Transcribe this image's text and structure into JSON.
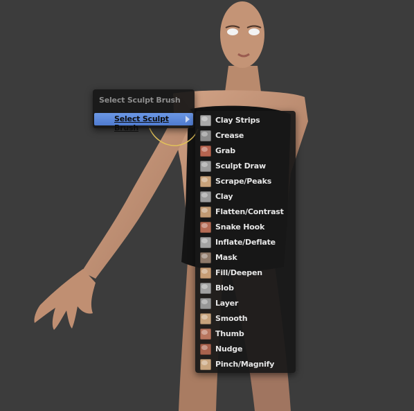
{
  "menus": {
    "parent": {
      "title": "Select Sculpt Brush",
      "item_label": "Select Sculpt Brush"
    },
    "brushes": [
      {
        "label": "Clay Strips",
        "icon": "clay-strips-brush-icon",
        "color": "#a9a9a9"
      },
      {
        "label": "Crease",
        "icon": "crease-brush-icon",
        "color": "#8c8c8c"
      },
      {
        "label": "Grab",
        "icon": "grab-brush-icon",
        "color": "#b5634f"
      },
      {
        "label": "Sculpt Draw",
        "icon": "sculpt-draw-brush-icon",
        "color": "#9c9c9c"
      },
      {
        "label": "Scrape/Peaks",
        "icon": "scrape-peaks-brush-icon",
        "color": "#c8a27a"
      },
      {
        "label": "Clay",
        "icon": "clay-brush-icon",
        "color": "#9b9b9b"
      },
      {
        "label": "Flatten/Contrast",
        "icon": "flatten-contrast-brush-icon",
        "color": "#c19a73"
      },
      {
        "label": "Snake Hook",
        "icon": "snake-hook-brush-icon",
        "color": "#b46b55"
      },
      {
        "label": "Inflate/Deflate",
        "icon": "inflate-deflate-brush-icon",
        "color": "#a3a3a3"
      },
      {
        "label": "Mask",
        "icon": "mask-brush-icon",
        "color": "#8f7a6a"
      },
      {
        "label": "Fill/Deepen",
        "icon": "fill-deepen-brush-icon",
        "color": "#c79d75"
      },
      {
        "label": "Blob",
        "icon": "blob-brush-icon",
        "color": "#a1a1a1"
      },
      {
        "label": "Layer",
        "icon": "layer-brush-icon",
        "color": "#979797"
      },
      {
        "label": "Smooth",
        "icon": "smooth-brush-icon",
        "color": "#c6a27c"
      },
      {
        "label": "Thumb",
        "icon": "thumb-brush-icon",
        "color": "#b8755e"
      },
      {
        "label": "Nudge",
        "icon": "nudge-brush-icon",
        "color": "#a8624d"
      },
      {
        "label": "Pinch/Magnify",
        "icon": "pinch-magnify-brush-icon",
        "color": "#c9a57e"
      }
    ]
  },
  "colors": {
    "viewport_bg": "#3c3c3c",
    "skin": "#c49476",
    "dress": "#141414",
    "highlight": "#5e8ad9"
  }
}
